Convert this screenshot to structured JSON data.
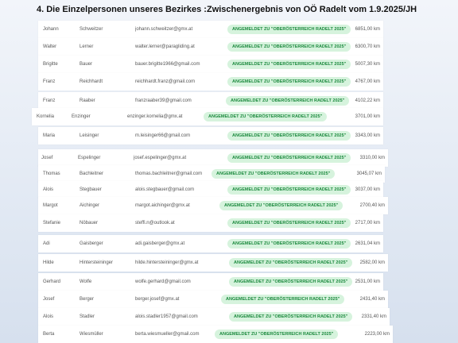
{
  "header": {
    "title": "4. Die Einzelpersonen unseres Bezirkes :Zwischenergebnis von OÖ Radelt vom 1.9.2025/JH"
  },
  "badge_color": "#1c8a3e",
  "rows": [
    {
      "first": "Johann",
      "last": "Schweitzer",
      "email": "johann.schweitzer@gmx.at",
      "status": "ANGEMELDET ZU \"OBERÖSTERREICH RADELT 2025\"",
      "km": "6851,00 km"
    },
    {
      "first": "Walter",
      "last": "Lerner",
      "email": "walter.lerner@paragliding.at",
      "status": "ANGEMELDET ZU \"OBERÖSTERREICH RADELT 2025\"",
      "km": "6300,70 km"
    },
    {
      "first": "Brigitte",
      "last": "Bauer",
      "email": "bauer.brigitte1966@gmail.com",
      "status": "ANGEMELDET ZU \"OBERÖSTERREICH RADELT 2025\"",
      "km": "5007,30 km"
    },
    {
      "first": "Franz",
      "last": "Reichhardt",
      "email": "reichhardt.franz@gmail.com",
      "status": "ANGEMELDET ZU \"OBERÖSTERREICH RADELT 2025\"",
      "km": "4767,00 km"
    },
    {
      "first": "Franz",
      "last": "Raaber",
      "email": "franzraaber39@gmail.com",
      "status": "ANGEMELDET ZU \"OBERÖSTERREICH RADELT 2025\"",
      "km": "4102,22 km"
    },
    {
      "first": "Kornelia",
      "last": "Enzinger",
      "email": "enzinger.kornelia@gmx.at",
      "status": "ANGEMELDET ZU \"OBERÖSTERREICH RADELT 2025\"",
      "km": "3701,00 km"
    },
    {
      "first": "Maria",
      "last": "Leisinger",
      "email": "m.leisinger66@gmail.com",
      "status": "ANGEMELDET ZU \"OBERÖSTERREICH RADELT 2025\"",
      "km": "3343,00 km"
    },
    {
      "first": "Josef",
      "last": "Espelinger",
      "email": "josef.espelinger@gmx.at",
      "status": "ANGEMELDET ZU \"OBERÖSTERREICH RADELT 2025\"",
      "km": "3310,00 km"
    },
    {
      "first": "Thomas",
      "last": "Bachleitner",
      "email": "thomas.bachleitner@gmail.com",
      "status": "ANGEMELDET ZU \"OBERÖSTERREICH RADELT 2025\"",
      "km": "3045,07 km"
    },
    {
      "first": "Alois",
      "last": "Stegbauer",
      "email": "alois.stegbauer@gmail.com",
      "status": "ANGEMELDET ZU \"OBERÖSTERREICH RADELT 2025\"",
      "km": "3037,00 km"
    },
    {
      "first": "Margot",
      "last": "Aichinger",
      "email": "margot.aichinger@gmx.at",
      "status": "ANGEMELDET ZU \"OBERÖSTERREICH RADELT 2025\"",
      "km": "2700,40 km"
    },
    {
      "first": "Stefanie",
      "last": "Nöbauer",
      "email": "steffi.n@outlook.at",
      "status": "ANGEMELDET ZU \"OBERÖSTERREICH RADELT 2025\"",
      "km": "2717,00 km"
    },
    {
      "first": "Adi",
      "last": "Gaisberger",
      "email": "adi.gaisberger@gmx.at",
      "status": "ANGEMELDET ZU \"OBERÖSTERREICH RADELT 2025\"",
      "km": "2631,04 km"
    },
    {
      "first": "Hilde",
      "last": "Hintersteininger",
      "email": "hilde.hintersteininger@gmx.at",
      "status": "ANGEMELDET ZU \"OBERÖSTERREICH RADELT 2025\"",
      "km": "2582,00 km"
    },
    {
      "first": "Gerhard",
      "last": "Wolfe",
      "email": "wolfe.gerhard@gmail.com",
      "status": "ANGEMELDET ZU \"OBERÖSTERREICH RADELT 2025\"",
      "km": "2531,00 km"
    },
    {
      "first": "Josef",
      "last": "Berger",
      "email": "berger.josef@gmx.at",
      "status": "ANGEMELDET ZU \"OBERÖSTERREICH RADELT 2025\"",
      "km": "2431,40 km"
    },
    {
      "first": "Alois",
      "last": "Stadler",
      "email": "alois.stadler1957@gmail.com",
      "status": "ANGEMELDET ZU \"OBERÖSTERREICH RADELT 2025\"",
      "km": "2331,40 km"
    },
    {
      "first": "Berta",
      "last": "Wiesmüller",
      "email": "berta.wiesmueller@gmail.com",
      "status": "ANGEMELDET ZU \"OBERÖSTERREICH RADELT 2025\"",
      "km": "2223,00 km"
    }
  ]
}
